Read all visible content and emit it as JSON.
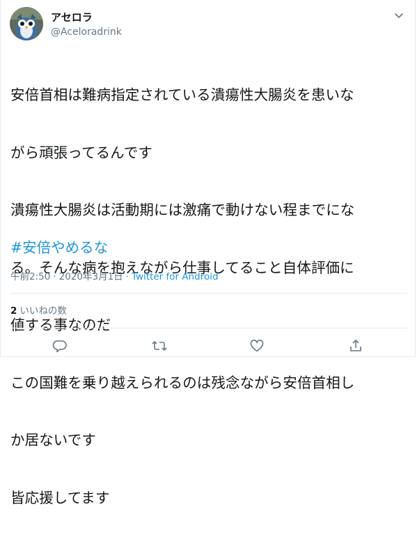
{
  "author": {
    "display_name": "アセロラ",
    "handle": "@Aceloradrink",
    "avatar_icon": "owl-avatar-icon"
  },
  "menu_icon": "chevron-down-icon",
  "tweet": {
    "text_lines": [
      "安倍首相は難病指定されている潰瘍性大腸炎を患いな",
      "がら頑張ってるんです",
      "潰瘍性大腸炎は活動期には激痛で動けない程までにな",
      "る。そんな病を抱えながら仕事してること自体評価に",
      "値する事なのだ",
      "この国難を乗り越えられるのは残念ながら安倍首相し",
      "か居ないです",
      "皆応援してます"
    ],
    "hashtag": "#安倍やめるな"
  },
  "meta": {
    "time": "午前2:50",
    "separator": "·",
    "date": "2020年3月1日",
    "source": "Twitter for Android"
  },
  "likes": {
    "count": "2",
    "label": "いいねの数"
  },
  "actions": [
    {
      "icon": "reply-icon"
    },
    {
      "icon": "retweet-icon"
    },
    {
      "icon": "like-icon"
    },
    {
      "icon": "share-icon"
    }
  ],
  "colors": {
    "link": "#1b95e0",
    "secondary_text": "#657786",
    "divider": "#e6ecf0"
  }
}
